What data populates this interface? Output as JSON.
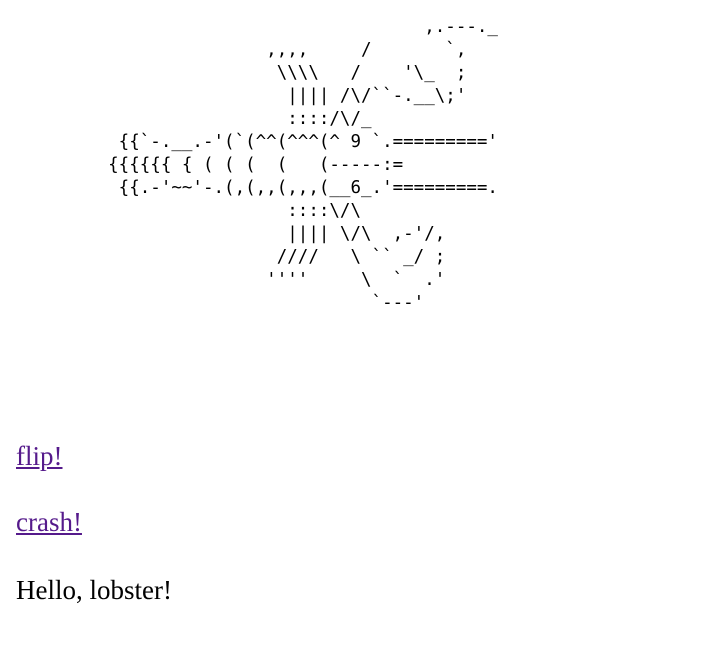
{
  "ascii_art": "                                  ,.---._\n                   ,,,,     /       `,\n                    \\\\\\\\   /    '\\_  ;\n                     |||| /\\/``-.__\\;'\n                     ::::/\\/_\n     {{`-.__.-'(`(^^(^^^(^ 9 `.========='\n    {{{{{{ { ( ( (  (   (-----:=\n     {{.-'~~'-.(,(,,(,,,(__6_.'=========.\n                     ::::\\/\\\n                     |||| \\/\\  ,-'/,\n                    ////   \\ `` _/ ;\n                   ''''     \\  `  .'\n                             `---'",
  "links": {
    "flip": "flip!",
    "crash": "crash!"
  },
  "greeting": "Hello, lobster!",
  "colors": {
    "visited_link": "#551a8b",
    "text": "#000000",
    "background": "#ffffff"
  }
}
